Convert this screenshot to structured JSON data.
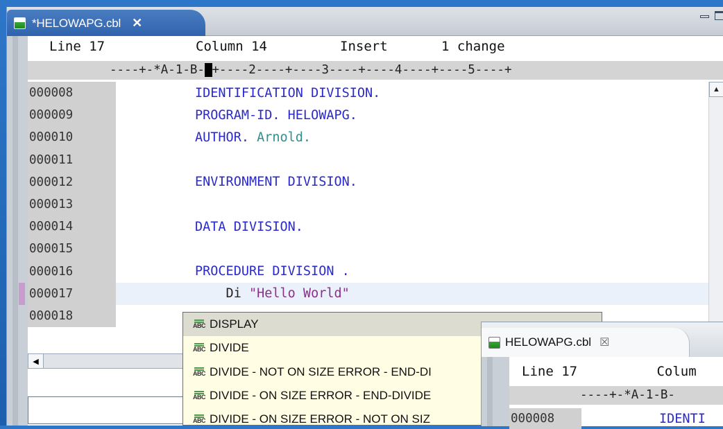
{
  "editor": {
    "tab_title": "*HELOWAPG.cbl",
    "tab_close": "✕",
    "status": {
      "line": "Line 17",
      "column": "Column 14",
      "mode": "Insert",
      "changes": "1 change"
    },
    "ruler_before": "----+-*A-1-B-",
    "ruler_cursor": "-",
    "ruler_after": "+----2----+----3----+----4----+----5----+",
    "lines": [
      {
        "num": "000008",
        "code": "IDENTIFICATION DIVISION."
      },
      {
        "num": "000009",
        "code": "PROGRAM-ID. HELOWAPG."
      },
      {
        "num": "000010",
        "kw": "AUTHOR.",
        "lit": " Arnold."
      },
      {
        "num": "000011",
        "code": ""
      },
      {
        "num": "000012",
        "code": "ENVIRONMENT DIVISION."
      },
      {
        "num": "000013",
        "code": ""
      },
      {
        "num": "000014",
        "code": "DATA DIVISION."
      },
      {
        "num": "000015",
        "code": ""
      },
      {
        "num": "000016",
        "code": "PROCEDURE DIVISION ."
      },
      {
        "num": "000017",
        "prefix": "    Di ",
        "str": "\"Hello World\""
      },
      {
        "num": "000018",
        "code": ""
      }
    ]
  },
  "autocomplete": {
    "items": [
      "DISPLAY",
      "DIVIDE",
      "DIVIDE - NOT ON SIZE ERROR - END-DI",
      "DIVIDE - ON SIZE ERROR - END-DIVIDE",
      "DIVIDE - ON SIZE ERROR - NOT ON SIZ"
    ],
    "icon_text": "ABC"
  },
  "secondary": {
    "tab_title": "HELOWAPG.cbl",
    "tab_close": "☒",
    "status": "Line 17          Colum",
    "ruler": "----+-*A-1-B-",
    "line_num": "000008",
    "line_code": "IDENTI"
  },
  "colors": {
    "keyword": "#2a2acc",
    "literal": "#2f8f8f",
    "string": "#8b2f8b",
    "tab_active": "#2e63ad"
  }
}
